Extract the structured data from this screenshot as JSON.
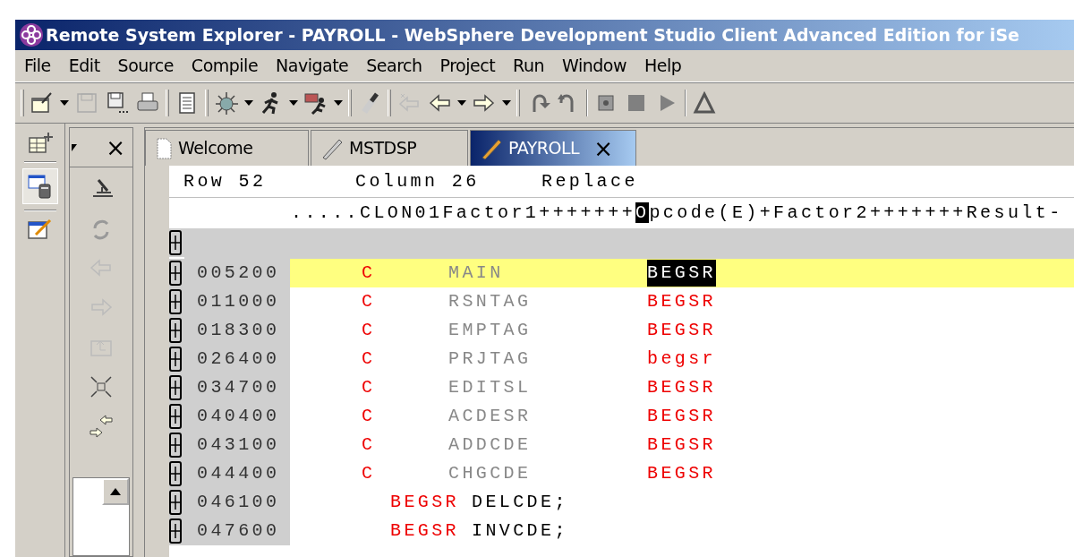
{
  "window": {
    "title": "Remote System Explorer - PAYROLL - WebSphere Development Studio Client Advanced Edition for iSe"
  },
  "menu": [
    "File",
    "Edit",
    "Source",
    "Compile",
    "Navigate",
    "Search",
    "Project",
    "Run",
    "Window",
    "Help"
  ],
  "tabs": [
    {
      "label": "Welcome",
      "kind": "page",
      "selected": false,
      "closable": false
    },
    {
      "label": "MSTDSP",
      "kind": "edit",
      "selected": false,
      "closable": false
    },
    {
      "label": "PAYROLL",
      "kind": "edit",
      "selected": true,
      "closable": true,
      "close": "×"
    }
  ],
  "view_close": "×",
  "status": {
    "row": "Row 52",
    "column": "Column 26",
    "mode": "Replace"
  },
  "ruler": {
    "before": ".....CLON01Factor1+++++++",
    "cursor": "O",
    "after": "pcode(E)+Factor2+++++++Result-"
  },
  "lines": [
    {
      "seq": "005200",
      "kind": "fixed",
      "spec": "C",
      "factor1": "MAIN",
      "opcode": "BEGSR",
      "current": true,
      "selected": true
    },
    {
      "seq": "011000",
      "kind": "fixed",
      "spec": "C",
      "factor1": "RSNTAG",
      "opcode": "BEGSR",
      "current": false,
      "selected": false
    },
    {
      "seq": "018300",
      "kind": "fixed",
      "spec": "C",
      "factor1": "EMPTAG",
      "opcode": "BEGSR",
      "current": false,
      "selected": false
    },
    {
      "seq": "026400",
      "kind": "fixed",
      "spec": "C",
      "factor1": "PRJTAG",
      "opcode": "begsr",
      "current": false,
      "selected": false
    },
    {
      "seq": "034700",
      "kind": "fixed",
      "spec": "C",
      "factor1": "EDITSL",
      "opcode": "BEGSR",
      "current": false,
      "selected": false
    },
    {
      "seq": "040400",
      "kind": "fixed",
      "spec": "C",
      "factor1": "ACDESR",
      "opcode": "BEGSR",
      "current": false,
      "selected": false
    },
    {
      "seq": "043100",
      "kind": "fixed",
      "spec": "C",
      "factor1": "ADDCDE",
      "opcode": "BEGSR",
      "current": false,
      "selected": false
    },
    {
      "seq": "044400",
      "kind": "fixed",
      "spec": "C",
      "factor1": "CHGCDE",
      "opcode": "BEGSR",
      "current": false,
      "selected": false
    },
    {
      "seq": "046100",
      "kind": "free",
      "keyword": "BEGSR",
      "rest": "DELCDE;",
      "current": false,
      "selected": false
    },
    {
      "seq": "047600",
      "kind": "free",
      "keyword": "BEGSR",
      "rest": "INVCDE;",
      "current": false,
      "selected": false
    }
  ]
}
